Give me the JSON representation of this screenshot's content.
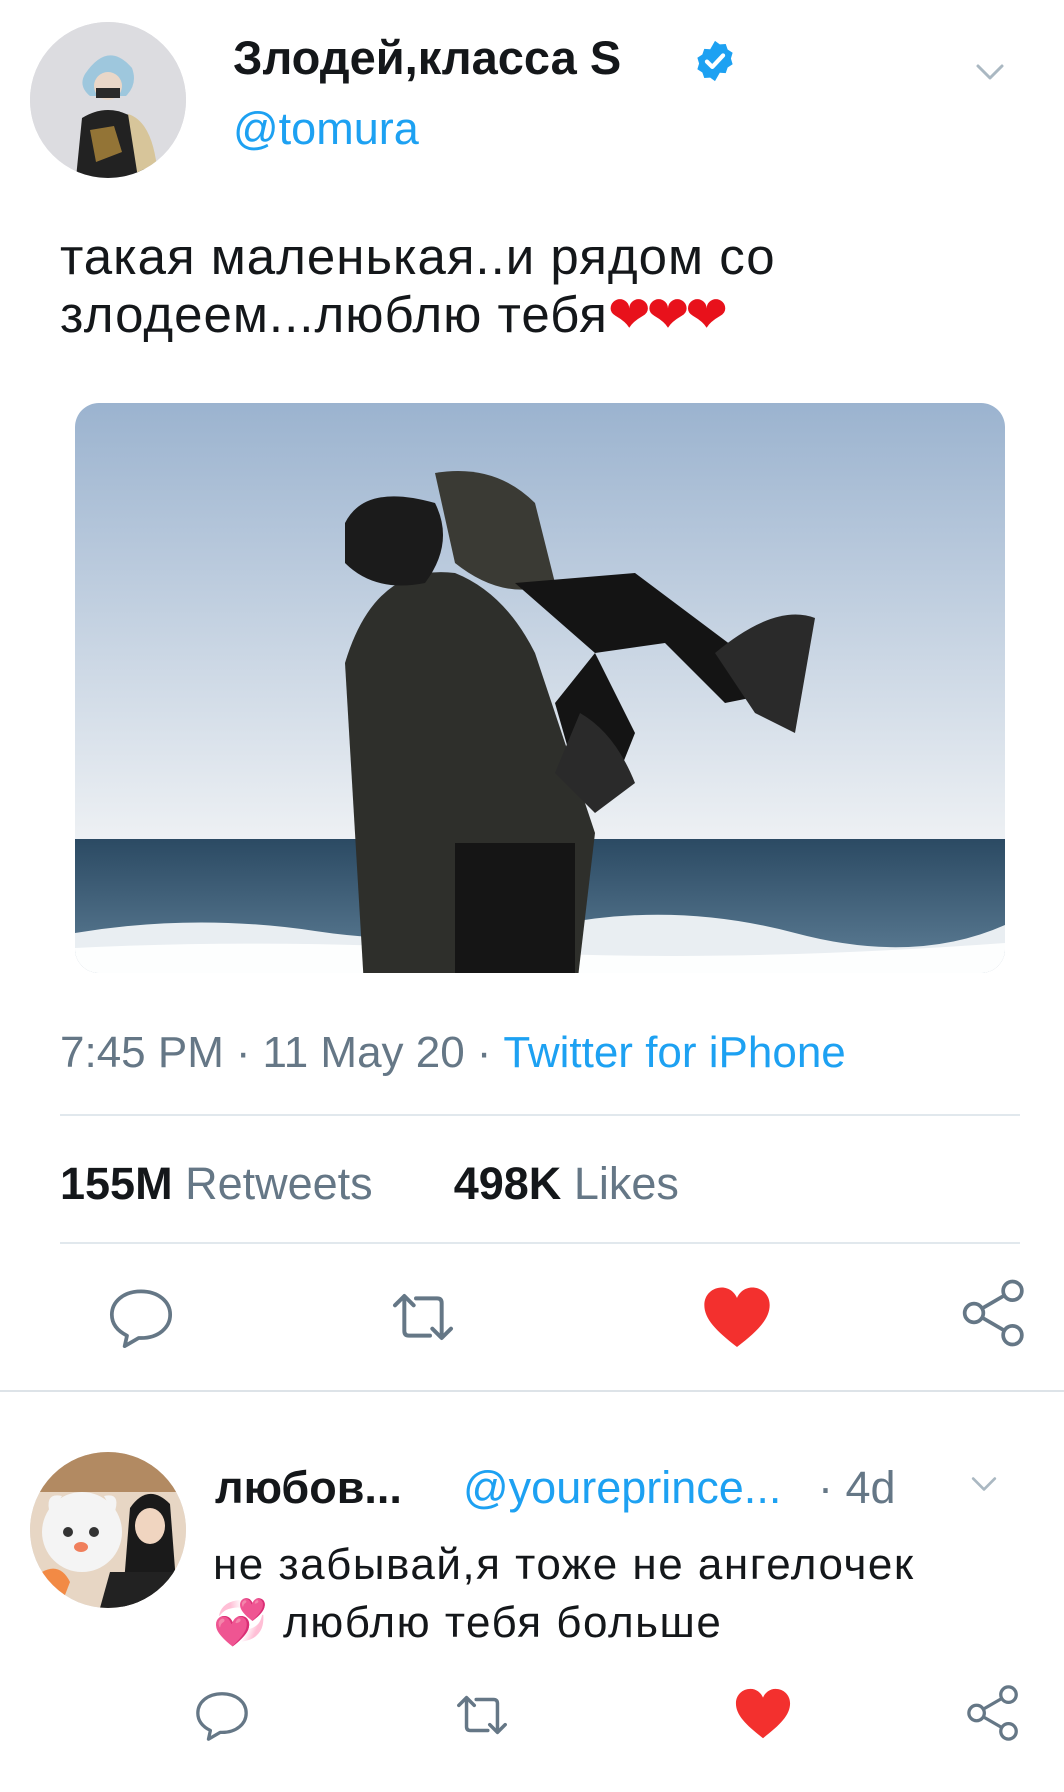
{
  "tweet": {
    "author": {
      "display_name": "Злодей,класса S",
      "handle": "@tomura",
      "verified": true,
      "avatar_icon": "avatar-image"
    },
    "text": "такая маленькая..и рядом со злодеем...люблю тебя",
    "text_emoji": "❤❤❤",
    "photo": {
      "description_icon": "photo-image"
    },
    "time": "7:45 PM",
    "date": "11 May 20",
    "source": "Twitter for iPhone",
    "separator": "·",
    "stats": {
      "retweets_count": "155M",
      "retweets_label": "Retweets",
      "likes_count": "498K",
      "likes_label": "Likes"
    },
    "actions": {
      "reply_icon": "reply-icon",
      "retweet_icon": "retweet-icon",
      "like_icon": "heart-icon",
      "share_icon": "share-icon",
      "liked": true
    }
  },
  "reply": {
    "author": {
      "display_name": "любов...",
      "handle": "@youreprince...",
      "time": "· 4d"
    },
    "text_before_emoji": "не забывай,я тоже не ангелочек",
    "emoji": "💞",
    "text_after_emoji": "люблю тебя больше",
    "liked": true
  },
  "colors": {
    "accent": "#1da1f2",
    "like": "#e0245e",
    "heart_red": "#f3302e",
    "text_primary": "#14171a",
    "text_secondary": "#657786",
    "divider": "#e1e8ed"
  }
}
